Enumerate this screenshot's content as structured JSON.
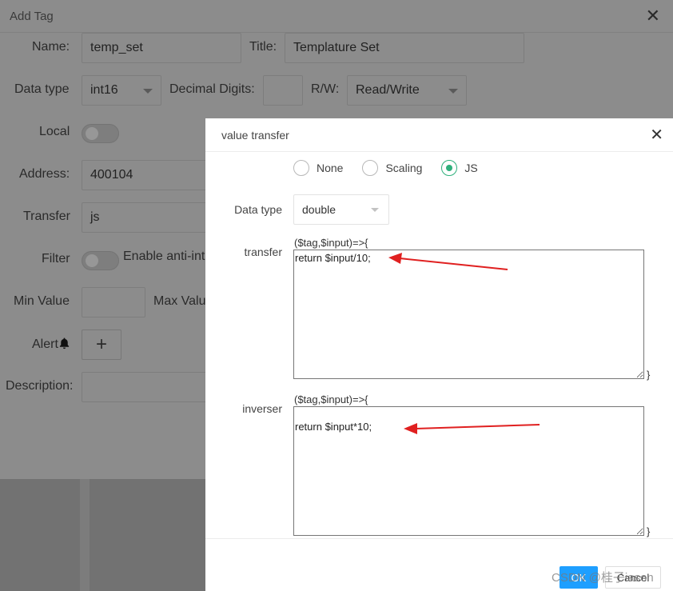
{
  "background_dialog": {
    "title": "Add Tag",
    "close_glyph": "✕",
    "name_label": "Name:",
    "name_value": "temp_set",
    "title_label": "Title:",
    "title_value": "Templature Set",
    "data_type_label": "Data type",
    "data_type_value": "int16",
    "decimal_digits_label": "Decimal Digits:",
    "decimal_digits_value": "",
    "rw_label": "R/W:",
    "rw_value": "Read/Write",
    "local_label": "Local",
    "address_label": "Address:",
    "address_value": "400104",
    "transfer_label": "Transfer",
    "transfer_value": "js",
    "filter_label": "Filter",
    "filter_text": "Enable anti-int",
    "min_value_label": "Min Value",
    "max_value_label": "Max Valu",
    "alert_label": "Alert",
    "alert_icon": "bell-icon",
    "add_glyph": "+",
    "description_label": "Description:"
  },
  "modal": {
    "title": "value transfer",
    "close_glyph": "✕",
    "radio_options": [
      {
        "label": "None",
        "checked": false
      },
      {
        "label": "Scaling",
        "checked": false
      },
      {
        "label": "JS",
        "checked": true
      }
    ],
    "data_type_label": "Data type",
    "data_type_value": "double",
    "transfer_label": "transfer",
    "transfer_header": "($tag,$input)=>{",
    "transfer_code": "return $input/10;",
    "transfer_close": "}",
    "inverser_label": "inverser",
    "inverser_header": "($tag,$input)=>{",
    "inverser_code": "\nreturn $input*10;",
    "inverser_close": "}",
    "ok_label": "OK",
    "cancel_label": "Cancel",
    "watermark": "CSDN @桂子iason"
  },
  "colors": {
    "accent_green": "#2fb07c",
    "primary_blue": "#1e9fff",
    "annotation_red": "#e02020"
  }
}
